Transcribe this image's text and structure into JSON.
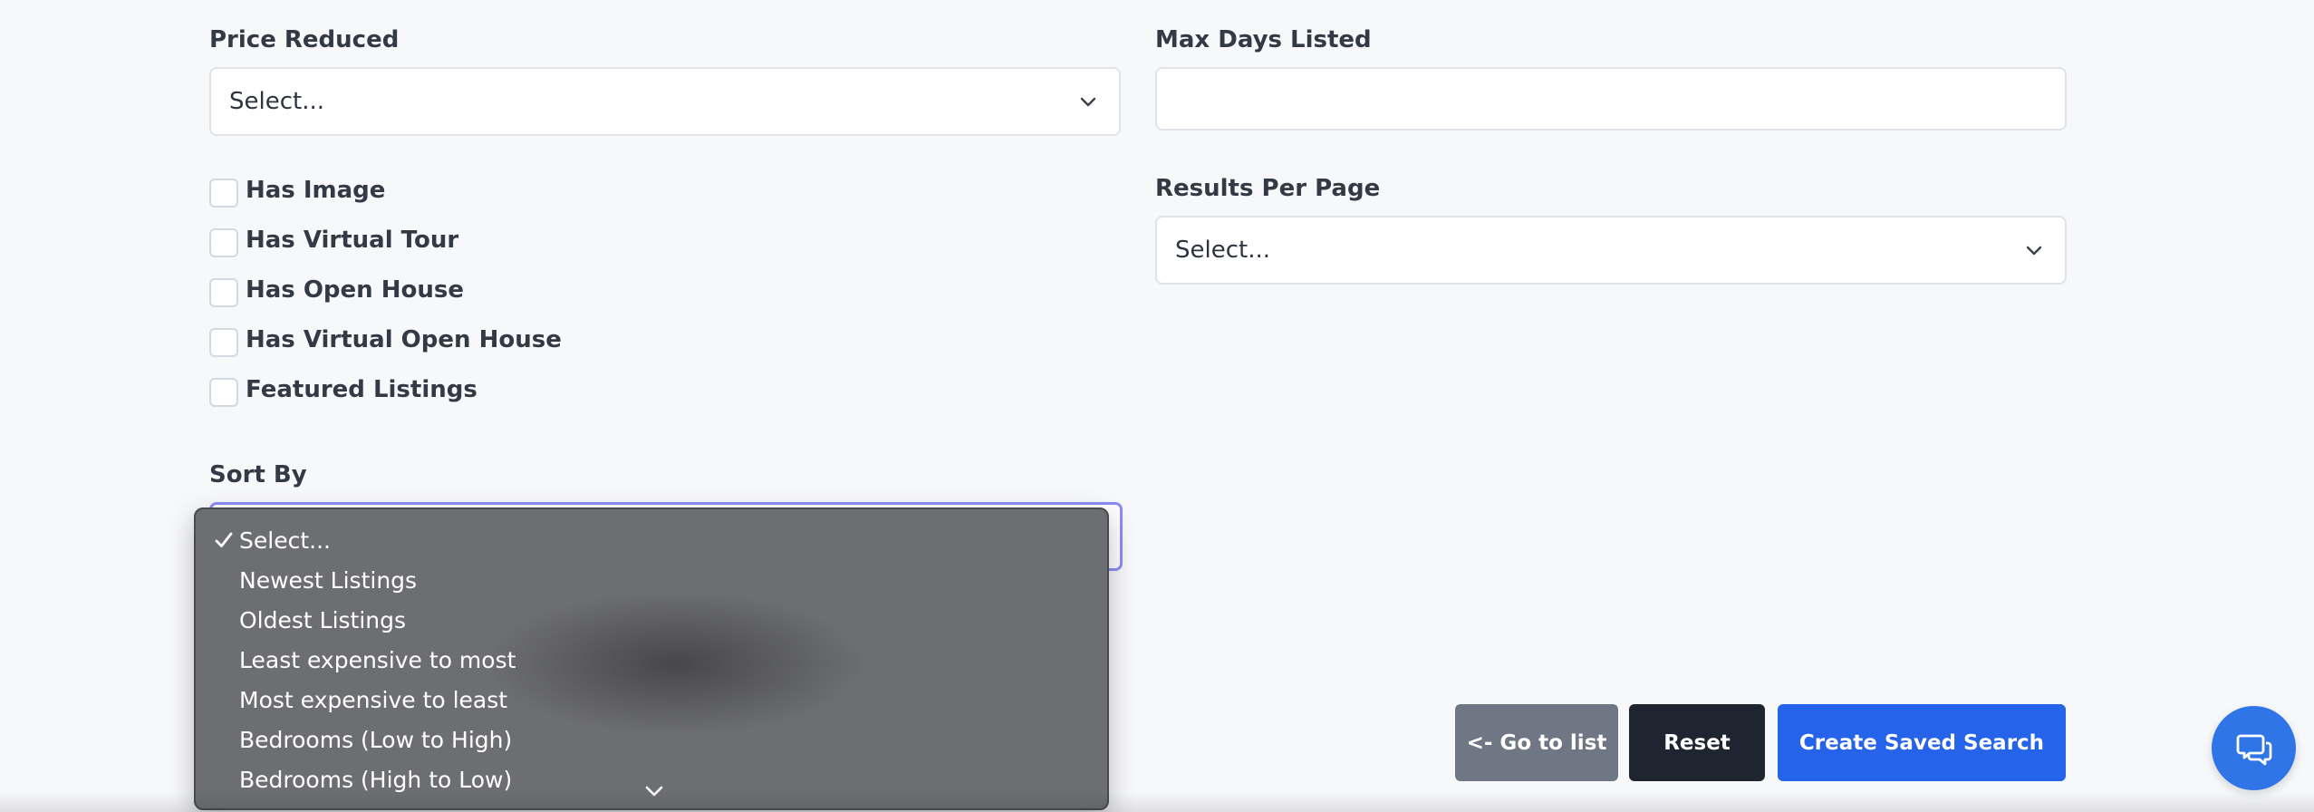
{
  "filters": {
    "price_reduced": {
      "label": "Price Reduced",
      "value": "Select..."
    },
    "max_days_listed": {
      "label": "Max Days Listed",
      "value": ""
    },
    "results_per_page": {
      "label": "Results Per Page",
      "value": "Select..."
    },
    "checkboxes": [
      {
        "label": "Has Image",
        "checked": false
      },
      {
        "label": "Has Virtual Tour",
        "checked": false
      },
      {
        "label": "Has Open House",
        "checked": false
      },
      {
        "label": "Has Virtual Open House",
        "checked": false
      },
      {
        "label": "Featured Listings",
        "checked": false
      }
    ],
    "sort_by": {
      "label": "Sort By",
      "selected": "Select...",
      "options": [
        "Select...",
        "Newest Listings",
        "Oldest Listings",
        "Least expensive to most",
        "Most expensive to least",
        "Bedrooms (Low to High)",
        "Bedrooms (High to Low)"
      ]
    }
  },
  "actions": {
    "go_to_list": "<- Go to list",
    "reset": "Reset",
    "create_saved_search": "Create Saved Search"
  },
  "icons": {
    "chevron": "chevron-down-icon",
    "check": "checkmark-icon",
    "chat": "chat-bubbles-icon"
  },
  "colors": {
    "primary": "#2563eb",
    "dark": "#1f2530",
    "secondary": "#6f7784",
    "focus": "#8d8cf7",
    "dropdown_bg": "#6d6e71"
  }
}
